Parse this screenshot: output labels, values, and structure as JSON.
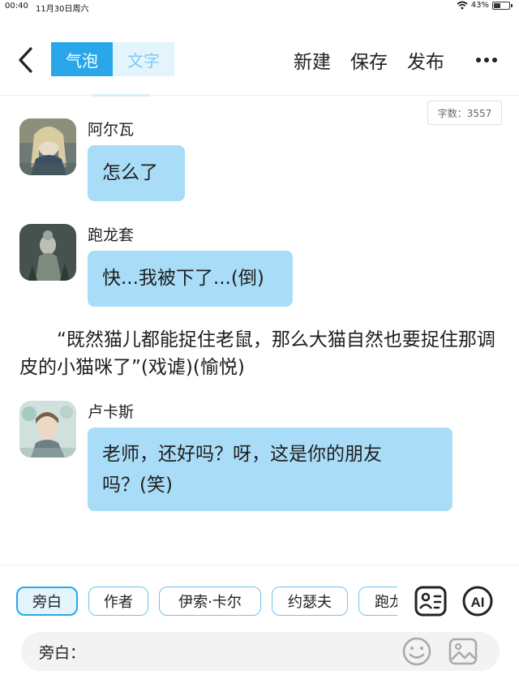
{
  "status_bar": {
    "time": "00:40",
    "date": "11月30日周六",
    "battery": "43%",
    "battery_level": 0.43,
    "icons": [
      "wifi-icon",
      "battery-icon"
    ]
  },
  "header": {
    "back_icon": "chevron-left-icon",
    "tabs": [
      {
        "label": "气泡",
        "active": true
      },
      {
        "label": "文字",
        "active": false
      }
    ],
    "actions": {
      "new": "新建",
      "save": "保存",
      "publish": "发布"
    },
    "more_icon": "more-dots-icon"
  },
  "word_count": "字数：3557",
  "messages": [
    {
      "speaker": "阿尔瓦",
      "text": "怎么了"
    },
    {
      "speaker": "跑龙套",
      "text": "快...我被下了...(倒)"
    }
  ],
  "narration": "“既然猫儿都能捉住老鼠，那么大猫自然也要捉住那调皮的小猫咪了”(戏谑)(愉悦)",
  "message3": {
    "speaker": "卢卡斯",
    "line1": "老师，还好吗？呀，这是你的朋友",
    "line2": "吗？(笑)"
  },
  "bottom": {
    "chips": [
      "旁白",
      "作者",
      "伊索·卡尔",
      "约瑟夫",
      "跑龙套"
    ],
    "tool_icons": [
      "character-card-icon",
      "ai-icon"
    ],
    "input_label": "旁白：",
    "input_value": "",
    "input_icons": [
      "emoji-icon",
      "image-icon"
    ]
  },
  "colors": {
    "accent": "#2aa7ea",
    "bubble": "#a9ddf7",
    "tab_inactive_bg": "#e3f4fc"
  }
}
